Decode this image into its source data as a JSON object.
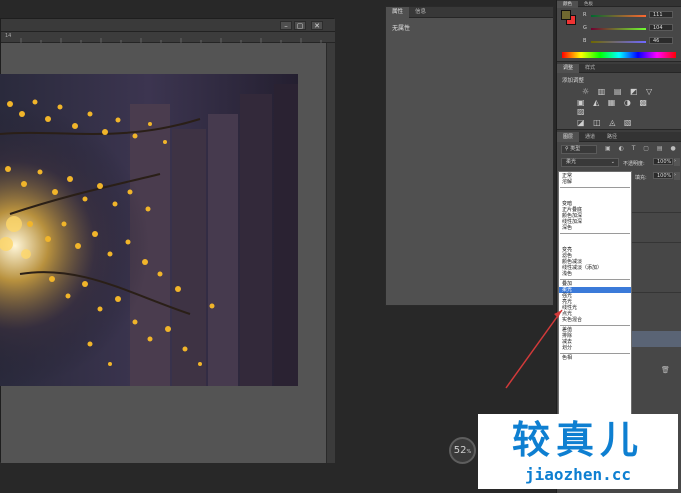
{
  "document": {
    "window_buttons": [
      "–",
      "▢",
      "✕"
    ],
    "ruler_label": "14"
  },
  "properties_panel": {
    "tabs": [
      "属性",
      "信息"
    ],
    "content_label": "无属性"
  },
  "color_panel": {
    "tabs": [
      "颜色",
      "色板"
    ],
    "channels": [
      {
        "label": "R",
        "value": "111"
      },
      {
        "label": "G",
        "value": "104"
      },
      {
        "label": "B",
        "value": "46"
      }
    ]
  },
  "adjust_panel": {
    "tabs": [
      "调整",
      "样式"
    ],
    "title": "添加调整"
  },
  "layers_panel": {
    "tabs": [
      "图层",
      "通道",
      "路径"
    ],
    "filter_label": "类型",
    "blend_mode_value": "柔光",
    "opacity_label": "不透明度:",
    "opacity_value": "100%",
    "fill_label": "填充:",
    "fill_value": "100%"
  },
  "blend_menu": {
    "groups": [
      [
        "正常",
        "溶解"
      ],
      [
        "变暗",
        "正片叠底",
        "颜色加深",
        "线性加深",
        "深色"
      ],
      [
        "变亮",
        "滤色",
        "颜色减淡",
        "线性减淡（添加）",
        "浅色"
      ],
      [
        "叠加",
        "柔光",
        "强光",
        "亮光",
        "线性光",
        "点光",
        "实色混合"
      ],
      [
        "差值",
        "排除",
        "减去",
        "划分"
      ],
      [
        "色相"
      ]
    ],
    "selected": "柔光"
  },
  "zoom": {
    "value": "52",
    "unit": "%"
  },
  "watermark": {
    "main": "较真儿",
    "sub": "jiaozhen.cc"
  }
}
